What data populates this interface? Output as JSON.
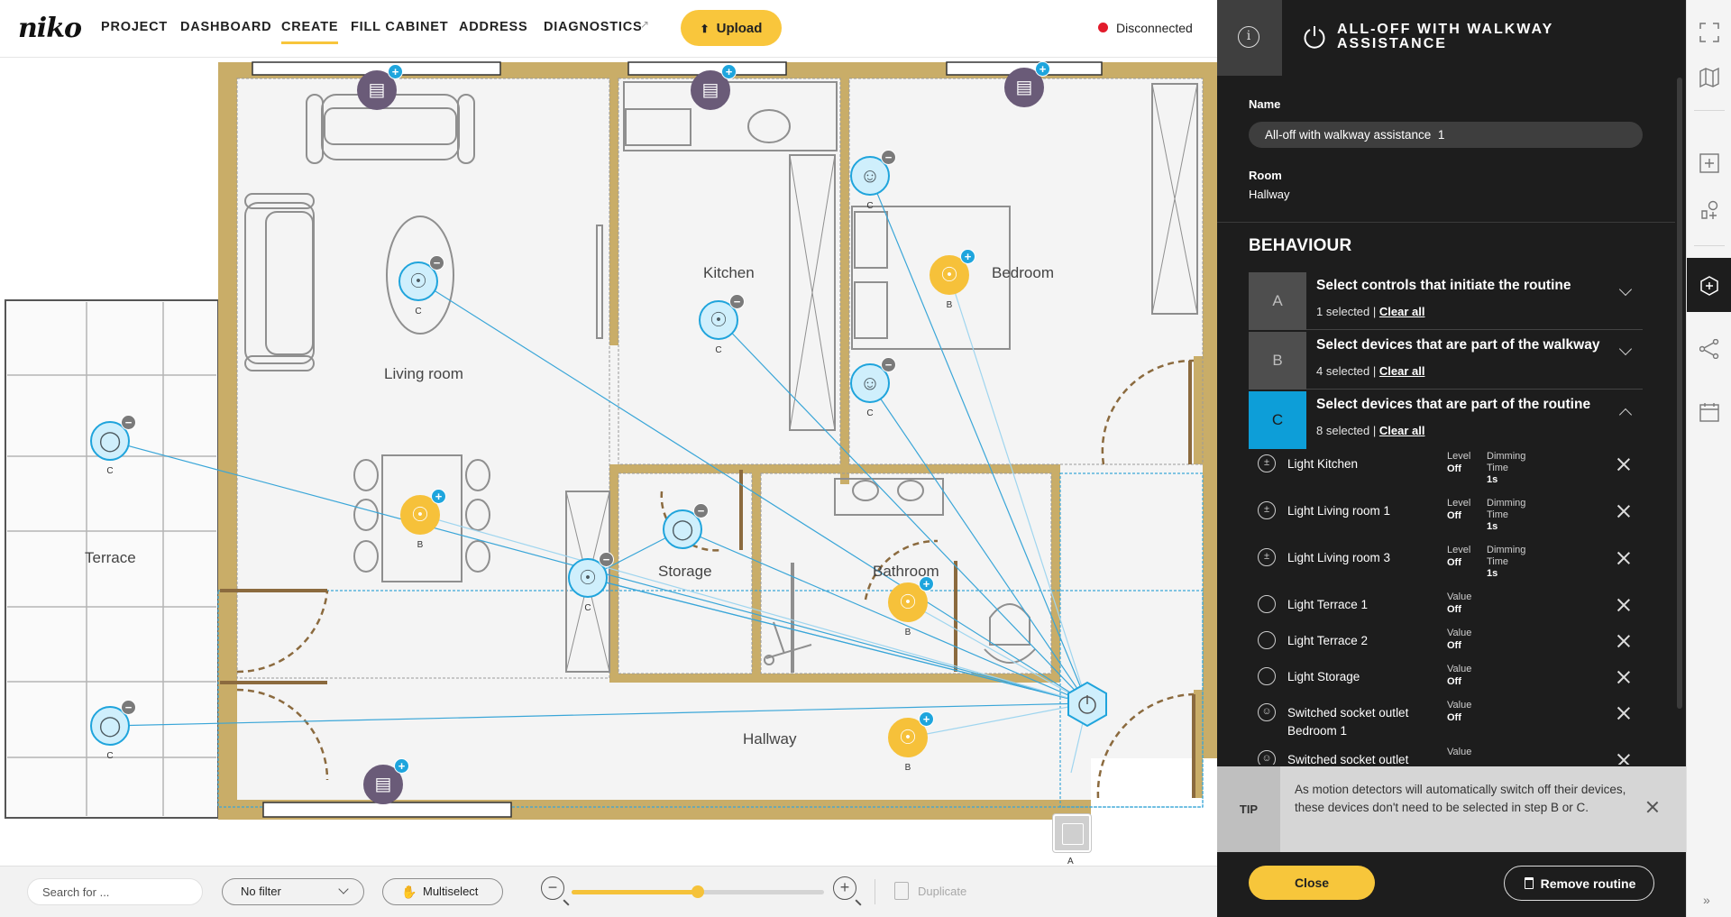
{
  "app": {
    "logo": "niko",
    "nav": [
      {
        "label": "PROJECT",
        "active": false
      },
      {
        "label": "DASHBOARD",
        "active": false
      },
      {
        "label": "CREATE",
        "active": true
      },
      {
        "label": "FILL CABINET",
        "active": false
      },
      {
        "label": "ADDRESS",
        "active": false
      },
      {
        "label": "DIAGNOSTICS",
        "active": false
      }
    ],
    "upload_label": "Upload",
    "status_text": "Disconnected",
    "status_color": "#e21b2b",
    "accent_color": "#f7c53b"
  },
  "rooms": {
    "living": "Living room",
    "kitchen": "Kitchen",
    "bedroom": "Bedroom",
    "terrace": "Terrace",
    "storage": "Storage",
    "bathroom": "Bathroom",
    "hallway": "Hallway"
  },
  "devices": [
    {
      "tag": "C",
      "kind": "dimmer",
      "color": "cyan"
    },
    {
      "tag": "C",
      "kind": "dimmer",
      "color": "cyan"
    },
    {
      "tag": "C",
      "kind": "socket",
      "color": "cyan"
    },
    {
      "tag": "B",
      "kind": "dimmer",
      "color": "yellow"
    },
    {
      "tag": "C",
      "kind": "socket",
      "color": "cyan"
    },
    {
      "tag": "C",
      "kind": "bulb",
      "color": "cyan"
    },
    {
      "tag": "B",
      "kind": "dimmer",
      "color": "yellow"
    },
    {
      "tag": "C",
      "kind": "dimmer",
      "color": "cyan"
    },
    {
      "tag": "",
      "kind": "bulb",
      "color": "cyan"
    },
    {
      "tag": "B",
      "kind": "dimmer",
      "color": "yellow"
    },
    {
      "tag": "C",
      "kind": "bulb",
      "color": "cyan"
    },
    {
      "tag": "B",
      "kind": "dimmer",
      "color": "yellow"
    }
  ],
  "hub_tag": "A",
  "toolbar": {
    "search_placeholder": "Search for ...",
    "filter_label": "No filter",
    "multiselect_label": "Multiselect",
    "duplicate_label": "Duplicate",
    "zoom_fraction": 0.5
  },
  "panel": {
    "title": "ALL-OFF WITH WALKWAY ASSISTANCE",
    "name_label": "Name",
    "name_value": "All-off with walkway assistance  1",
    "room_label": "Room",
    "room_value": "Hallway",
    "behaviour_heading": "BEHAVIOUR",
    "clear_all": "Clear all",
    "steps": [
      {
        "letter": "A",
        "title": "Select controls that initiate the routine",
        "count": "1 selected | "
      },
      {
        "letter": "B",
        "title": "Select devices that are part of the walkway",
        "count": "4 selected | "
      },
      {
        "letter": "C",
        "title": "Select devices that are part of the routine",
        "count": "8 selected | "
      }
    ],
    "device_rows": [
      {
        "name": "Light Kitchen",
        "icon": "dimmer-icon",
        "p1_label": "Level",
        "p1_value": "Off",
        "p2_label": "Dimming Time",
        "p2_value": "1s"
      },
      {
        "name": "Light Living room 1",
        "icon": "dimmer-icon",
        "p1_label": "Level",
        "p1_value": "Off",
        "p2_label": "Dimming Time",
        "p2_value": "1s"
      },
      {
        "name": "Light Living room 3",
        "icon": "dimmer-icon",
        "p1_label": "Level",
        "p1_value": "Off",
        "p2_label": "Dimming Time",
        "p2_value": "1s"
      },
      {
        "name": "Light Terrace 1",
        "icon": "bulb-icon",
        "p1_label": "Value",
        "p1_value": "Off"
      },
      {
        "name": "Light Terrace 2",
        "icon": "bulb-icon",
        "p1_label": "Value",
        "p1_value": "Off"
      },
      {
        "name": "Light Storage",
        "icon": "bulb-icon",
        "p1_label": "Value",
        "p1_value": "Off"
      },
      {
        "name": "Switched socket outlet Bedroom 1",
        "icon": "socket-icon",
        "p1_label": "Value",
        "p1_value": "Off"
      },
      {
        "name": "Switched socket outlet",
        "icon": "socket-icon",
        "p1_label": "Value",
        "p1_value": ""
      }
    ],
    "tip_tag": "TIP",
    "tip_text": "As motion detectors will automatically switch off their devices, these devices don't need to be selected in step B or C.",
    "close_label": "Close",
    "remove_label": "Remove routine"
  }
}
